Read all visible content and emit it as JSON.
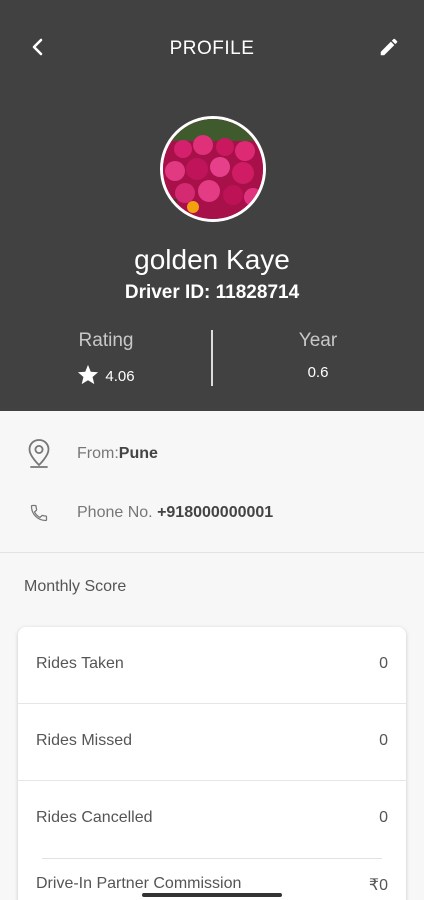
{
  "header": {
    "title": "PROFILE",
    "back_icon": "chevron-left-icon",
    "edit_icon": "pencil-icon"
  },
  "profile": {
    "name": "golden Kaye",
    "driver_id_label": "Driver ID:",
    "driver_id": "11828714"
  },
  "stats": {
    "rating_label": "Rating",
    "rating_value": "4.06",
    "year_label": "Year",
    "year_value": "0.6"
  },
  "info": {
    "from_label": "From:",
    "from_value": "Pune",
    "phone_label": "Phone No.",
    "phone_value": "+918000000001"
  },
  "monthly": {
    "title": "Monthly Score",
    "rows": [
      {
        "label": "Rides Taken",
        "value": "0"
      },
      {
        "label": "Rides Missed",
        "value": "0"
      },
      {
        "label": "Rides Cancelled",
        "value": "0"
      },
      {
        "label": "Drive-In Partner Commission",
        "value": "₹0"
      }
    ]
  },
  "colors": {
    "header_bg": "#414141",
    "page_bg": "#f7f7f7"
  }
}
